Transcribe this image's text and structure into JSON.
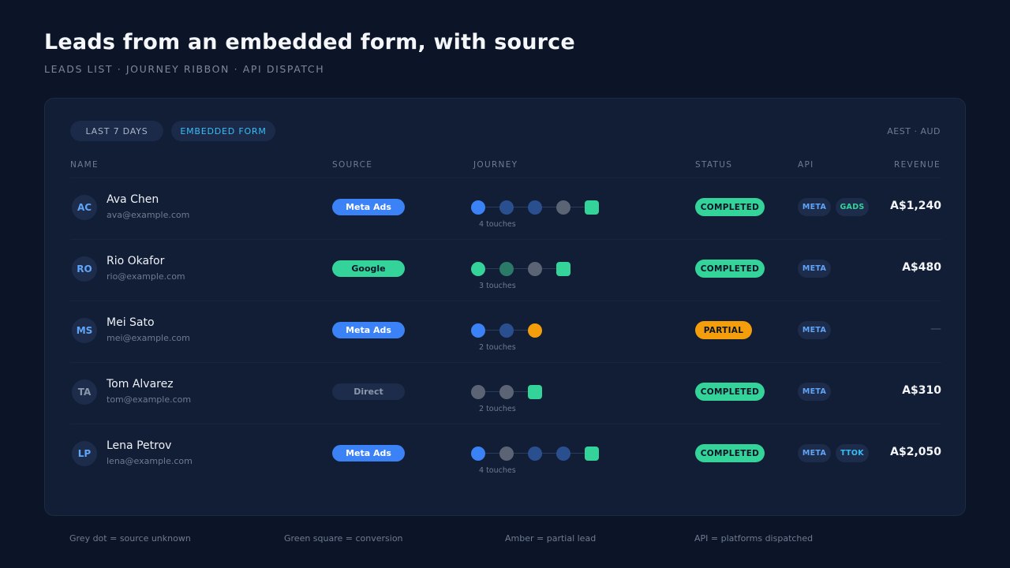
{
  "page": {
    "title": "Leads from an embedded form, with source",
    "subtitle": "LEADS LIST · JOURNEY RIBBON · API DISPATCH"
  },
  "filters": {
    "range_label": "LAST 7 DAYS",
    "form_label": "EMBEDDED FORM"
  },
  "meta_label": "AEST · AUD",
  "columns": {
    "name": "NAME",
    "source": "SOURCE",
    "journey": "JOURNEY",
    "status": "STATUS",
    "api": "API",
    "revenue": "REVENUE"
  },
  "colors": {
    "meta_blue": "#3b82f6",
    "meta_blue_dim": "#2a4f8f",
    "google_green": "#34d399",
    "google_green_dim": "#2a7a68",
    "unknown_grey": "#5a6475",
    "conversion": "#34d399",
    "partial_amber": "#f59e0b",
    "tiktok_cyan": "#38bdf8"
  },
  "leads": [
    {
      "initials": "AC",
      "initials_color": "#60a5fa",
      "name": "Ava Chen",
      "email": "ava@example.com",
      "source": "Meta Ads",
      "source_bg": "#3b82f6",
      "source_fg": "#ffffff",
      "journey": [
        "meta",
        "meta-dim",
        "meta-dim",
        "unknown",
        "conversion"
      ],
      "touches": "4 touches",
      "status": "COMPLETED",
      "status_color": "#34d399",
      "api": [
        {
          "label": "META",
          "color": "#60a5fa"
        },
        {
          "label": "GADS",
          "color": "#34d399"
        }
      ],
      "revenue": "A$1,240"
    },
    {
      "initials": "RO",
      "initials_color": "#60a5fa",
      "name": "Rio Okafor",
      "email": "rio@example.com",
      "source": "Google",
      "source_bg": "#34d399",
      "source_fg": "#0b1527",
      "journey": [
        "google",
        "google-dim",
        "unknown",
        "conversion"
      ],
      "touches": "3 touches",
      "status": "COMPLETED",
      "status_color": "#34d399",
      "api": [
        {
          "label": "META",
          "color": "#60a5fa"
        }
      ],
      "revenue": "A$480"
    },
    {
      "initials": "MS",
      "initials_color": "#60a5fa",
      "name": "Mei Sato",
      "email": "mei@example.com",
      "source": "Meta Ads",
      "source_bg": "#3b82f6",
      "source_fg": "#ffffff",
      "journey": [
        "meta",
        "meta-dim",
        "partial"
      ],
      "touches": "2 touches",
      "status": "PARTIAL",
      "status_color": "#f59e0b",
      "api": [
        {
          "label": "META",
          "color": "#60a5fa"
        }
      ],
      "revenue": "—"
    },
    {
      "initials": "TA",
      "initials_color": "#8b97ab",
      "name": "Tom Alvarez",
      "email": "tom@example.com",
      "source": "Direct",
      "source_bg": "#1d2c4a",
      "source_fg": "#8b97ab",
      "journey": [
        "unknown",
        "unknown",
        "conversion"
      ],
      "touches": "2 touches",
      "status": "COMPLETED",
      "status_color": "#34d399",
      "api": [
        {
          "label": "META",
          "color": "#60a5fa"
        }
      ],
      "revenue": "A$310"
    },
    {
      "initials": "LP",
      "initials_color": "#60a5fa",
      "name": "Lena Petrov",
      "email": "lena@example.com",
      "source": "Meta Ads",
      "source_bg": "#3b82f6",
      "source_fg": "#ffffff",
      "journey": [
        "meta",
        "unknown",
        "meta-dim",
        "meta-dim",
        "conversion"
      ],
      "touches": "4 touches",
      "status": "COMPLETED",
      "status_color": "#34d399",
      "api": [
        {
          "label": "META",
          "color": "#60a5fa"
        },
        {
          "label": "TTOK",
          "color": "#38bdf8"
        }
      ],
      "revenue": "A$2,050"
    }
  ],
  "legend": [
    "Grey dot = source unknown",
    "Green square = conversion",
    "Amber = partial lead",
    "API = platforms dispatched"
  ]
}
